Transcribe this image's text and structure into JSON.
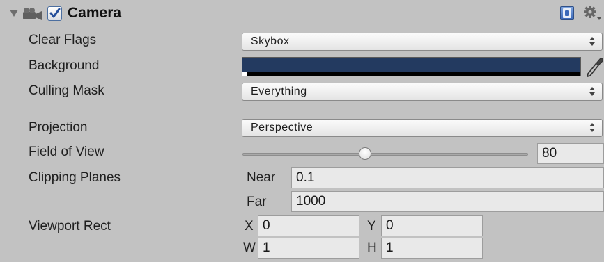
{
  "component": {
    "title": "Camera",
    "enabled": true,
    "icons": {
      "foldout": "foldout-arrow-icon",
      "component": "camera-icon",
      "help": "help-book-icon",
      "settings": "gear-icon"
    }
  },
  "properties": {
    "clear_flags": {
      "label": "Clear Flags",
      "value": "Skybox"
    },
    "background": {
      "label": "Background",
      "color": "#233a60",
      "alpha_indicator": "white",
      "icon": "eyedropper-icon"
    },
    "culling_mask": {
      "label": "Culling Mask",
      "value": "Everything"
    },
    "projection": {
      "label": "Projection",
      "value": "Perspective"
    },
    "field_of_view": {
      "label": "Field of View",
      "value": "80",
      "slider_fraction": 0.43
    },
    "clipping_planes": {
      "label": "Clipping Planes",
      "near_label": "Near",
      "near_value": "0.1",
      "far_label": "Far",
      "far_value": "1000"
    },
    "viewport_rect": {
      "label": "Viewport Rect",
      "x_label": "X",
      "x_value": "0",
      "y_label": "Y",
      "y_value": "0",
      "w_label": "W",
      "w_value": "1",
      "h_label": "H",
      "h_value": "1"
    }
  }
}
